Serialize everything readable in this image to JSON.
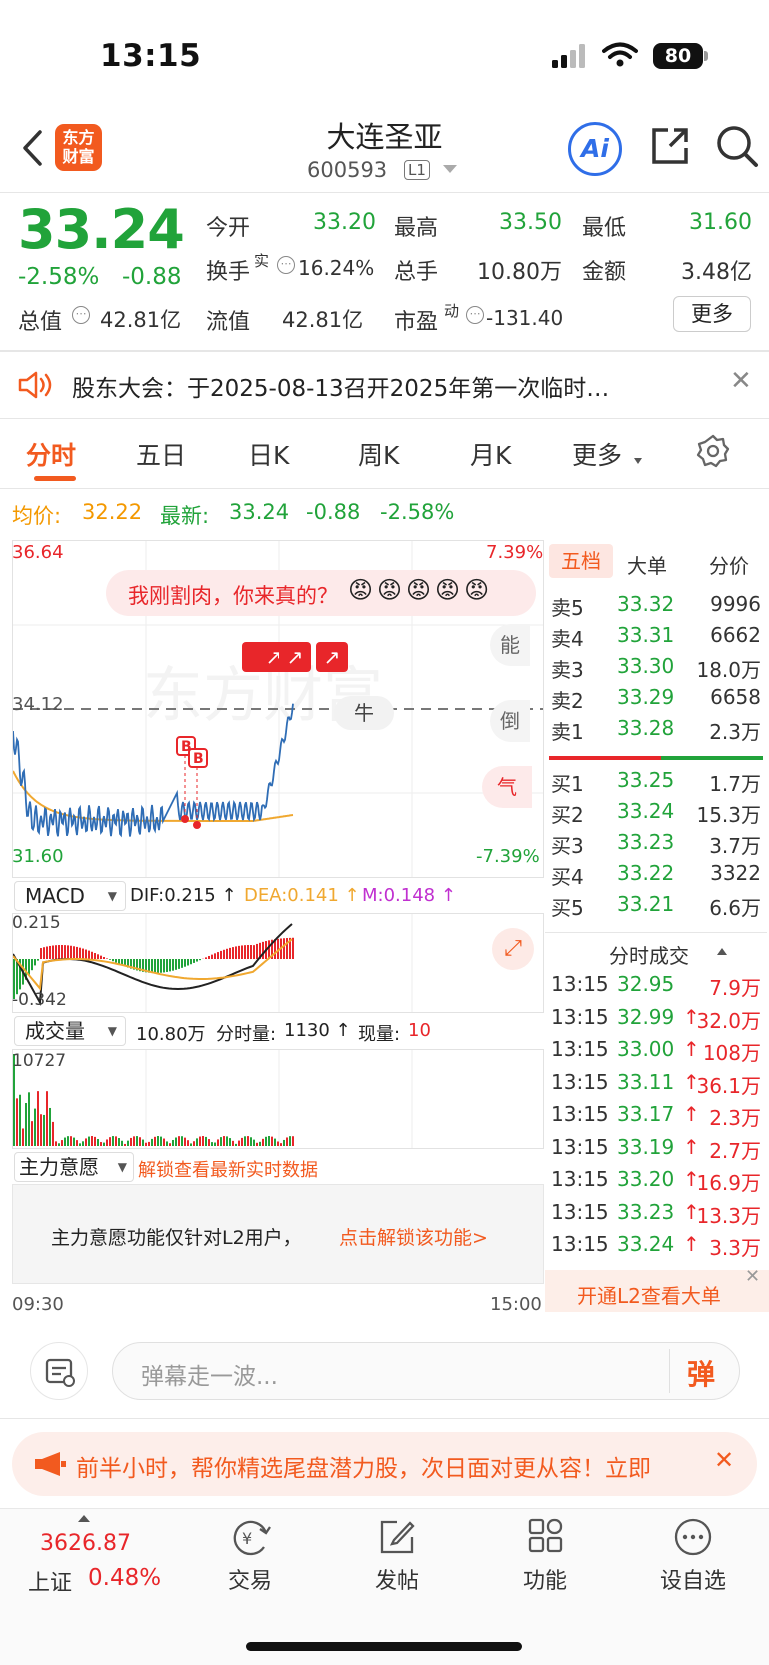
{
  "status_bar": {
    "time": "13:15",
    "battery": "80"
  },
  "header": {
    "stock_name": "大连圣亚",
    "stock_code": "600593",
    "level_badge": "L1",
    "ai_label": "Ai",
    "logo_text": "东方财富"
  },
  "quote": {
    "price": "33.24",
    "change_pct": "-2.58%",
    "change_val": "-0.88",
    "open_label": "今开",
    "open": "33.20",
    "high_label": "最高",
    "high": "33.50",
    "low_label": "最低",
    "low": "31.60",
    "turnover_label": "换手",
    "turnover_sup": "实",
    "turnover": "16.24%",
    "volume_label": "总手",
    "volume": "10.80万",
    "amount_label": "金额",
    "amount": "3.48亿",
    "mktcap_label": "总值",
    "mktcap": "42.81亿",
    "float_label": "流值",
    "float_cap": "42.81亿",
    "pe_label": "市盈",
    "pe_sup": "动",
    "pe": "-131.40",
    "more_button": "更多"
  },
  "notice": {
    "text": "股东大会：于2025-08-13召开2025年第一次临时…"
  },
  "tabs": [
    "分时",
    "五日",
    "日K",
    "周K",
    "月K",
    "更多"
  ],
  "avg_line": {
    "avg_label": "均价:",
    "avg_value": "32.22",
    "latest_label": "最新:",
    "latest_value": "33.24",
    "change": "-0.88",
    "pct": "-2.58%"
  },
  "chart": {
    "y_top": "36.64",
    "y_ref": "34.12",
    "y_bottom": "31.60",
    "pct_top": "7.39%",
    "pct_bottom": "-7.39%",
    "danmu": "我刚割肉，你来真的？",
    "danmu_side_1": "能",
    "danmu_side_2": "倒",
    "danmu_side_3": "气",
    "bull_text": "牛",
    "watermark": "东方财富",
    "marker": "B",
    "macd_label": "MACD",
    "dif": "DIF:0.215 ↑",
    "dea": "DEA:0.141 ↑",
    "m": "M:0.148 ↑",
    "macd_top": "0.215",
    "macd_bottom": "-0.342",
    "vol_label": "成交量",
    "vol_total": "10.80万",
    "vol_min_label": "分时量:",
    "vol_min": "1130 ↑",
    "vol_now_label": "现量:",
    "vol_now": "10",
    "vol_max": "10727",
    "main_label": "主力意愿",
    "main_unlock": "解锁查看最新实时数据",
    "main_notice": "主力意愿功能仅针对L2用户，",
    "main_link": "点击解锁该功能>",
    "t_start": "09:30",
    "t_end": "15:00"
  },
  "orderbook": {
    "tabs": [
      "五档",
      "大单",
      "分价"
    ],
    "sells": [
      {
        "label": "卖5",
        "price": "33.32",
        "vol": "9996"
      },
      {
        "label": "卖4",
        "price": "33.31",
        "vol": "6662"
      },
      {
        "label": "卖3",
        "price": "33.30",
        "vol": "18.0万"
      },
      {
        "label": "卖2",
        "price": "33.29",
        "vol": "6658"
      },
      {
        "label": "卖1",
        "price": "33.28",
        "vol": "2.3万"
      }
    ],
    "buys": [
      {
        "label": "买1",
        "price": "33.25",
        "vol": "1.7万"
      },
      {
        "label": "买2",
        "price": "33.24",
        "vol": "15.3万"
      },
      {
        "label": "买3",
        "price": "33.23",
        "vol": "3.7万"
      },
      {
        "label": "买4",
        "price": "33.22",
        "vol": "3322"
      },
      {
        "label": "买5",
        "price": "33.21",
        "vol": "6.6万"
      }
    ],
    "ticks_title": "分时成交",
    "ticks": [
      {
        "time": "13:15",
        "price": "32.95",
        "vol": "7.9万",
        "arrow": ""
      },
      {
        "time": "13:15",
        "price": "32.99",
        "vol": "32.0万",
        "arrow": "↑"
      },
      {
        "time": "13:15",
        "price": "33.00",
        "vol": "108万",
        "arrow": "↑"
      },
      {
        "time": "13:15",
        "price": "33.11",
        "vol": "36.1万",
        "arrow": "↑"
      },
      {
        "time": "13:15",
        "price": "33.17",
        "vol": "2.3万",
        "arrow": "↑"
      },
      {
        "time": "13:15",
        "price": "33.19",
        "vol": "2.7万",
        "arrow": "↑"
      },
      {
        "time": "13:15",
        "price": "33.20",
        "vol": "16.9万",
        "arrow": "↑"
      },
      {
        "time": "13:15",
        "price": "33.23",
        "vol": "13.3万",
        "arrow": "↑"
      },
      {
        "time": "13:15",
        "price": "33.24",
        "vol": "3.3万",
        "arrow": "↑"
      }
    ],
    "l2_banner": "开通L2查看大单"
  },
  "danmu_input": {
    "placeholder": "弹幕走一波...",
    "send": "弹"
  },
  "promo": {
    "text": "前半小时，帮你精选尾盘潜力股，次日面对更从容！立即"
  },
  "bottom_nav": {
    "index_value": "3626.87",
    "index_name": "上证",
    "index_pct": "0.48%",
    "items": [
      "交易",
      "发帖",
      "功能",
      "设自选"
    ]
  },
  "colors": {
    "up": "#e8262a",
    "down": "#21a33a",
    "accent": "#f25a1f",
    "avg_line": "#f0a830",
    "price_line": "#2f6db5"
  }
}
